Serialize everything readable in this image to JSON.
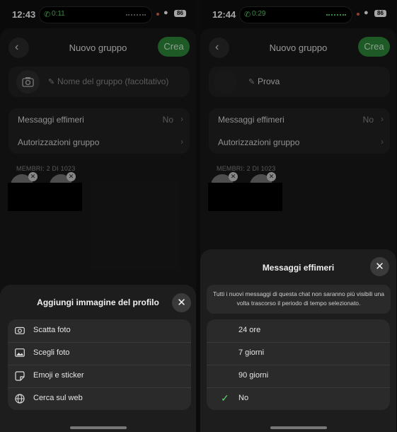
{
  "left": {
    "status": {
      "time": "12:43",
      "call_duration": "0:11",
      "battery": "86"
    },
    "nav": {
      "title": "Nuovo gruppo",
      "create_label": "Crea"
    },
    "name_field": {
      "placeholder": "Nome del gruppo (facoltativo)"
    },
    "settings": [
      {
        "label": "Messaggi effimeri",
        "value": "No"
      },
      {
        "label": "Autorizzazioni gruppo",
        "value": ""
      }
    ],
    "members_label": "MEMBRI: 2 DI 1023",
    "sheet": {
      "title": "Aggiungi immagine del profilo",
      "options": [
        {
          "icon": "camera-icon",
          "label": "Scatta foto"
        },
        {
          "icon": "image-icon",
          "label": "Scegli foto"
        },
        {
          "icon": "sticker-icon",
          "label": "Emoji e sticker"
        },
        {
          "icon": "globe-icon",
          "label": "Cerca sul web"
        }
      ]
    }
  },
  "right": {
    "status": {
      "time": "12:44",
      "call_duration": "0:29",
      "battery": "86"
    },
    "nav": {
      "title": "Nuovo gruppo",
      "create_label": "Crea"
    },
    "name_field": {
      "value": "Prova"
    },
    "settings": [
      {
        "label": "Messaggi effimeri",
        "value": "No"
      },
      {
        "label": "Autorizzazioni gruppo",
        "value": ""
      }
    ],
    "members_label": "MEMBRI: 2 DI 1023",
    "sheet": {
      "title": "Messaggi effimeri",
      "info": "Tutti i nuovi messaggi di questa chat non saranno più visibili una volta trascorso il periodo di tempo selezionato.",
      "options": [
        {
          "label": "24 ore",
          "selected": false
        },
        {
          "label": "7 giorni",
          "selected": false
        },
        {
          "label": "90 giorni",
          "selected": false
        },
        {
          "label": "No",
          "selected": true
        }
      ]
    }
  },
  "colors": {
    "accent_green": "#2f8a3b",
    "check_green": "#5fd36b",
    "sheet_bg": "#1d1d1d"
  }
}
